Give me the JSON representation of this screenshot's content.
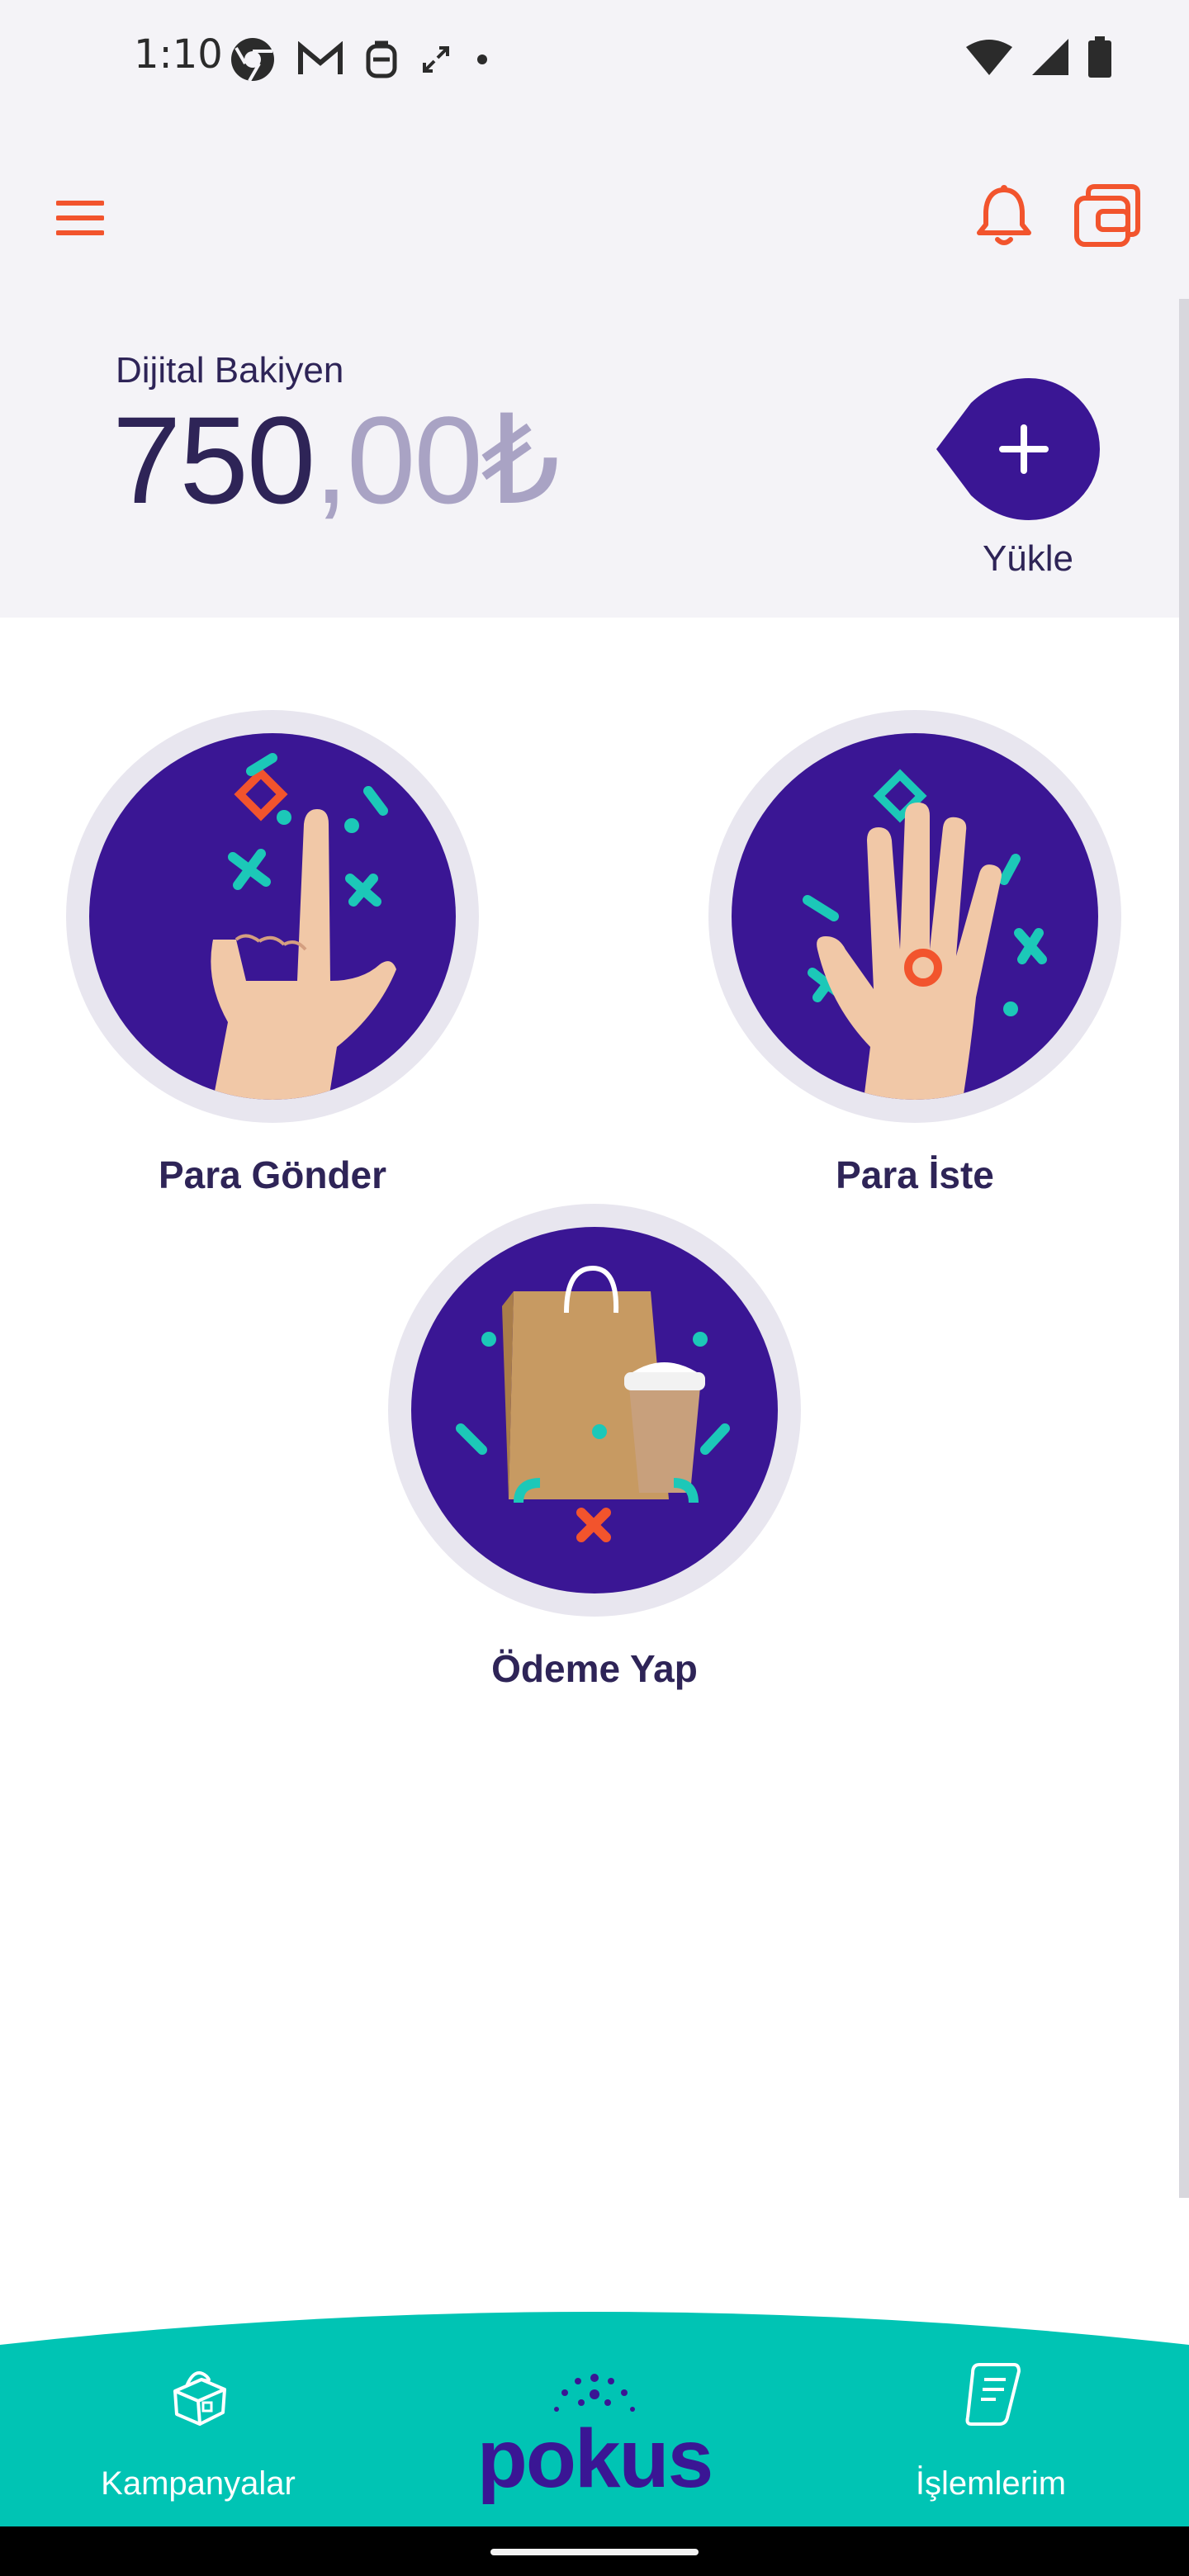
{
  "status_bar": {
    "time": "1:10",
    "icons_left": [
      "chrome-icon",
      "gmail-icon",
      "robot-icon",
      "expand-icon",
      "dot-icon"
    ],
    "icons_right": [
      "wifi-icon",
      "signal-icon",
      "battery-icon"
    ]
  },
  "header": {
    "menu_icon": "hamburger-menu-icon",
    "bell_icon": "bell-icon",
    "wallet_icon": "wallet-icon",
    "accent_color": "#f2542d"
  },
  "balance": {
    "label": "Dijital Bakiyen",
    "amount_integer": "750",
    "amount_decimal": ",00₺",
    "load_label": "Yükle",
    "load_color": "#3a1694"
  },
  "actions": [
    {
      "label": "Para Gönder",
      "icon": "pointing-hand-icon"
    },
    {
      "label": "Para İste",
      "icon": "open-hand-icon"
    },
    {
      "label": "Ödeme Yap",
      "icon": "shopping-bag-coffee-icon"
    }
  ],
  "bottom_nav": {
    "left_label": "Kampanyalar",
    "left_icon": "gift-box-icon",
    "brand": "pokus",
    "right_label": "İşlemlerim",
    "right_icon": "receipt-scroll-icon",
    "bar_color": "#00c4b4"
  }
}
